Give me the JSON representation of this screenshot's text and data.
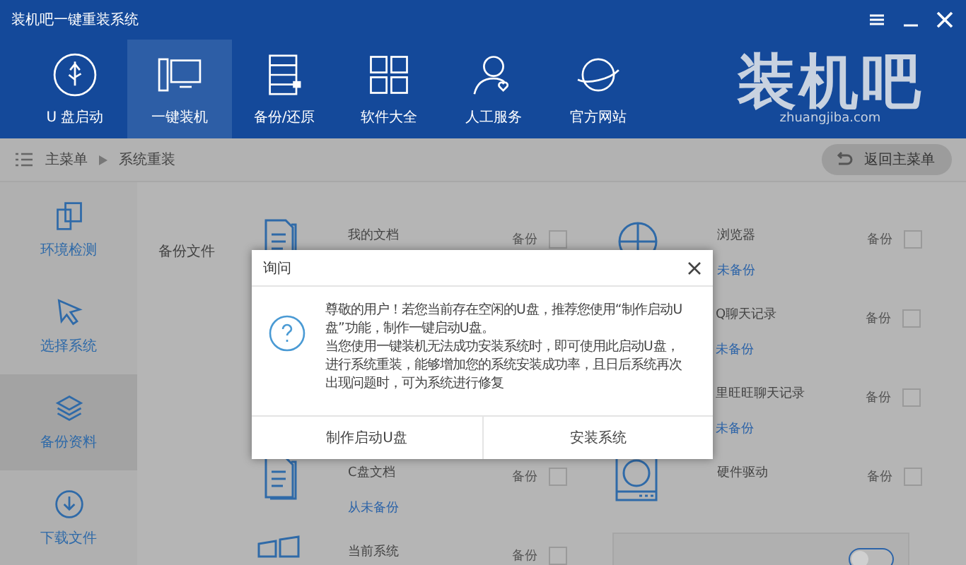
{
  "window": {
    "title": "装机吧一键重装系统"
  },
  "nav": [
    {
      "label": "U 盘启动",
      "kind": "usb",
      "selected": false
    },
    {
      "label": "一键装机",
      "kind": "computer",
      "selected": true
    },
    {
      "label": "备份/还原",
      "kind": "drawer",
      "selected": false
    },
    {
      "label": "软件大全",
      "kind": "grid",
      "selected": false
    },
    {
      "label": "人工服务",
      "kind": "person",
      "selected": false
    },
    {
      "label": "官方网站",
      "kind": "planet",
      "selected": false
    }
  ],
  "logo": {
    "text": "装机吧",
    "subtitle": "zhuangjiba.com"
  },
  "breadcrumb": {
    "items": [
      "主菜单",
      "系统重装"
    ],
    "back_button": "返回主菜单"
  },
  "sidebar": [
    {
      "label": "环境检测",
      "kind": "devices",
      "selected": false
    },
    {
      "label": "选择系统",
      "kind": "cursor",
      "selected": false
    },
    {
      "label": "备份资料",
      "kind": "layers",
      "selected": true
    },
    {
      "label": "下载文件",
      "kind": "download",
      "selected": false
    }
  ],
  "backup": {
    "label": "备份文件",
    "rows": [
      {
        "left": {
          "kind": "document",
          "name": "我的文档",
          "backup_label": "备份",
          "checked": false
        },
        "right": {
          "kind": "globe",
          "name": "浏览器",
          "status": "未备份",
          "backup_label": "备份",
          "checked": false
        }
      },
      {
        "right": {
          "kind": "none",
          "name": "Q聊天记录",
          "status": "未备份",
          "backup_label": "备份",
          "checked": false
        }
      },
      {
        "right": {
          "kind": "none",
          "name": "里旺旺聊天记录",
          "status": "未备份",
          "backup_label": "备份",
          "checked": false
        }
      },
      {
        "left": {
          "kind": "document",
          "name": "C盘文档",
          "status": "从未备份",
          "backup_label": "备份",
          "checked": false
        },
        "right": {
          "kind": "drive",
          "name": "硬件驱动",
          "backup_label": "备份",
          "checked": false
        }
      },
      {
        "left": {
          "kind": "windows",
          "name": "当前系统",
          "backup_label": "备份",
          "checked": false
        },
        "right": {
          "kind": "panel",
          "on": false
        }
      }
    ]
  },
  "dialog": {
    "title": "询问",
    "paragraphs": [
      "尊敬的用户！若您当前存在空闲的U盘，推荐您使用“制作启动U盘”功能，制作一键启动U盘。",
      "当您使用一键装机无法成功安装系统时，即可使用此启动U盘，进行系统重装，能够增加您的系统安装成功率，且日后系统再次出现问题时，可为系统进行修复"
    ],
    "buttons": [
      "制作启动U盘",
      "安装系统"
    ]
  }
}
